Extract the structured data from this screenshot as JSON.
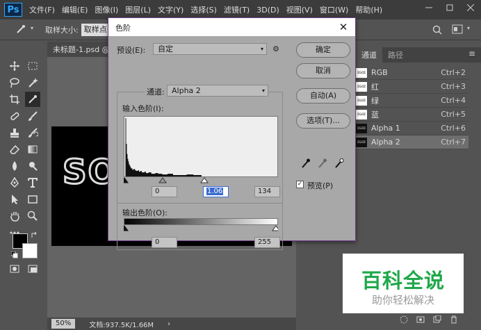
{
  "app": {
    "logo": "Ps",
    "menu": [
      "文件(F)",
      "编辑(E)",
      "图像(I)",
      "图层(L)",
      "文字(Y)",
      "选择(S)",
      "滤镜(T)",
      "3D(D)",
      "视图(V)",
      "窗口(W)",
      "帮助(H)"
    ],
    "window_controls": [
      "minimize-icon",
      "restore-icon",
      "close-icon"
    ]
  },
  "options_bar": {
    "sample_size_label": "取样大小:",
    "sample_size_value": "取样点"
  },
  "document": {
    "tab_title": "未标题-1.psd @",
    "canvas_text": "SO",
    "zoom": "50%",
    "doc_info": "文档:937.5K/1.66M",
    "status_arrow": "›"
  },
  "channels_panel": {
    "tabs": [
      "通道",
      "路径"
    ],
    "rows": [
      {
        "name": "RGB",
        "shortcut": "Ctrl+2",
        "thumb": "ɪɢɑɪ",
        "selected": false
      },
      {
        "name": "红",
        "shortcut": "Ctrl+3",
        "thumb": "ɪɢɑɪ",
        "selected": false
      },
      {
        "name": "绿",
        "shortcut": "Ctrl+4",
        "thumb": "ɪɢɑɪ",
        "selected": false
      },
      {
        "name": "蓝",
        "shortcut": "Ctrl+5",
        "thumb": "ɪɢɑɪ",
        "selected": false
      },
      {
        "name": "Alpha 1",
        "shortcut": "Ctrl+6",
        "thumb": "ɪɢɑɪ",
        "selected": false
      },
      {
        "name": "Alpha 2",
        "shortcut": "Ctrl+7",
        "thumb": "ɪɢɑɪ",
        "selected": true
      }
    ]
  },
  "levels_dialog": {
    "title": "色阶",
    "close": "✕",
    "preset_label": "预设(E):",
    "preset_value": "自定",
    "channel_label": "通道:",
    "channel_value": "Alpha 2",
    "input_levels_label": "输入色阶(I):",
    "input_black": "0",
    "input_gamma": "1.06",
    "input_white": "134",
    "output_levels_label": "输出色阶(O):",
    "output_black": "0",
    "output_white": "255",
    "buttons": {
      "ok": "确定",
      "cancel": "取消",
      "auto": "自动(A)",
      "options": "选项(T)..."
    },
    "preview_label": "预览(P)",
    "preview_checked": true,
    "check_mark": "✓"
  },
  "watermark": {
    "title": "百科全说",
    "subtitle": "助你轻松解决"
  },
  "colors": {
    "accent": "#31a8ff",
    "selection": "#3a6bd0",
    "watermark_green": "#1fa84a",
    "dialog_border": "#6e3f8a"
  }
}
